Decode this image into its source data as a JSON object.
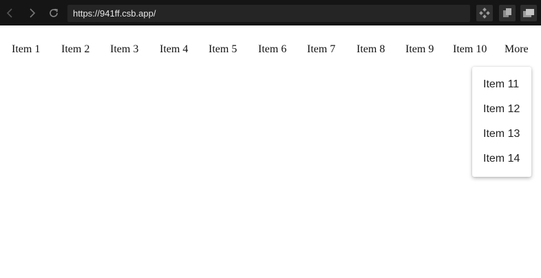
{
  "browser": {
    "url": "https://941ff.csb.app/",
    "icons": {
      "back": "chevron-left-icon",
      "forward": "chevron-right-icon",
      "reload": "reload-icon",
      "tool1": "diamond-grid-icon",
      "tool2": "copy-icon",
      "tool3": "windows-icon"
    }
  },
  "menu": {
    "items": [
      "Item 1",
      "Item 2",
      "Item 3",
      "Item 4",
      "Item 5",
      "Item 6",
      "Item 7",
      "Item 8",
      "Item 9",
      "Item 10"
    ],
    "more_label": "More"
  },
  "dropdown": {
    "items": [
      "Item 11",
      "Item 12",
      "Item 13",
      "Item 14"
    ]
  },
  "colors": {
    "toolbar_bg": "#151515",
    "address_bg": "#252525",
    "text": "#111111"
  }
}
